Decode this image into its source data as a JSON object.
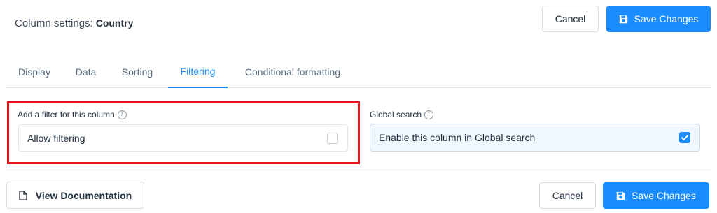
{
  "header": {
    "title_prefix": "Column settings:",
    "column_name": "Country",
    "cancel_label": "Cancel",
    "save_label": "Save Changes"
  },
  "tabs": [
    {
      "label": "Display",
      "active": false
    },
    {
      "label": "Data",
      "active": false
    },
    {
      "label": "Sorting",
      "active": false
    },
    {
      "label": "Filtering",
      "active": true
    },
    {
      "label": "Conditional formatting",
      "active": false
    }
  ],
  "filter": {
    "label": "Add a filter for this column",
    "option_label": "Allow filtering",
    "checked": false
  },
  "global_search": {
    "label": "Global search",
    "option_label": "Enable this column in Global search",
    "checked": true
  },
  "footer": {
    "doc_label": "View Documentation",
    "cancel_label": "Cancel",
    "save_label": "Save Changes"
  },
  "colors": {
    "accent": "#1a8cff",
    "highlight": "#e8141b"
  },
  "icons": {
    "save": "floppy-disk-icon",
    "doc": "document-icon",
    "info": "info-icon",
    "check": "checkmark-icon"
  }
}
